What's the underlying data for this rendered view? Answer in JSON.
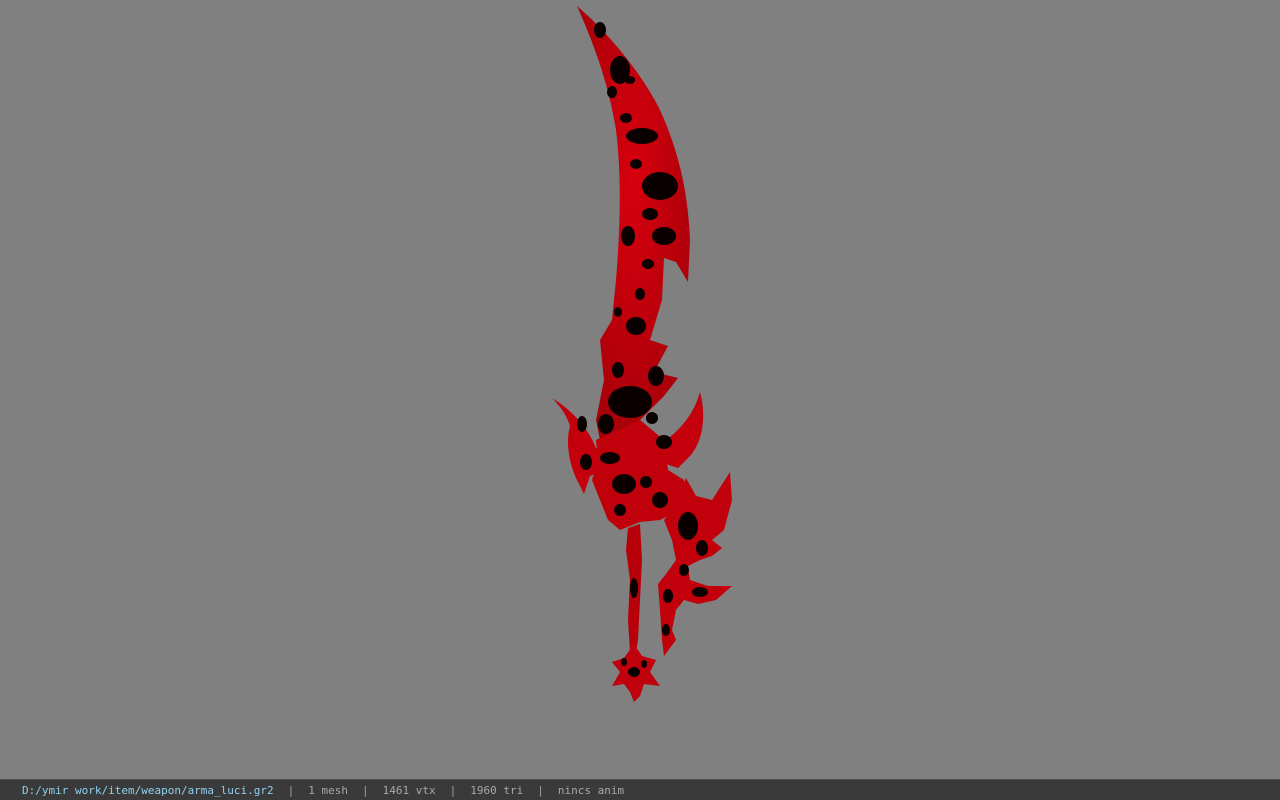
{
  "viewer": {
    "background_color": "#808080",
    "model": {
      "icon": "sword-model",
      "primary_color": "#c8000c",
      "stain_color": "#0a0000"
    }
  },
  "status_bar": {
    "file_path": "D:/ymir work/item/weapon/arma_luci.gr2",
    "separator": "|",
    "mesh_count": "1 mesh",
    "vertex_count": "1461 vtx",
    "triangle_count": "1960 tri",
    "animation": "nincs anim"
  }
}
